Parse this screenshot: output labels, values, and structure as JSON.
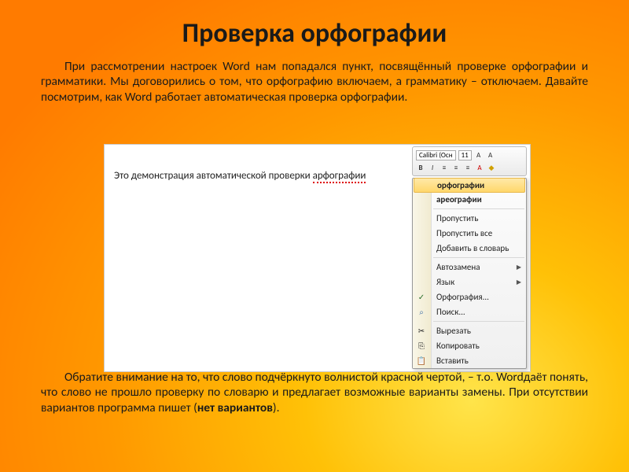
{
  "title": "Проверка орфографии",
  "para1": "При рассмотрении настроек Word нам попадался пункт, посвящённый проверке орфографии и грамматики. Мы договорились о том, что орфографию включаем, а грамматику – отключаем. Давайте посмотрим, как Word работает автоматическая проверка орфографии.",
  "demo": {
    "prefix": "Это демонстрация автоматической проверки ",
    "wrong_word": "арфографии"
  },
  "toolbar": {
    "font_name": "Calibri (Осн",
    "font_size": "11",
    "row2_symbols": [
      "B",
      "I",
      "≡",
      "≡",
      "≡",
      "A",
      "◆"
    ]
  },
  "menu": {
    "suggest1": "орфографии",
    "suggest2": "ареографии",
    "skip": "Пропустить",
    "skip_all": "Пропустить все",
    "add_dict": "Добавить в словарь",
    "autocorrect": "Автозамена",
    "language": "Язык",
    "spellcheck": "Орфография...",
    "find": "Поиск...",
    "cut": "Вырезать",
    "copy": "Копировать",
    "paste": "Вставить"
  },
  "para2_a": "Обратите внимание на то, что слово подчёркнуто волнистой красной чертой, – т.о. Wordдаёт понять, что слово не прошло проверку по словарю и предлагает возможные варианты замены. При отсутствии вариантов программа пишет (",
  "para2_bold": "нет вариантов",
  "para2_b": ")."
}
